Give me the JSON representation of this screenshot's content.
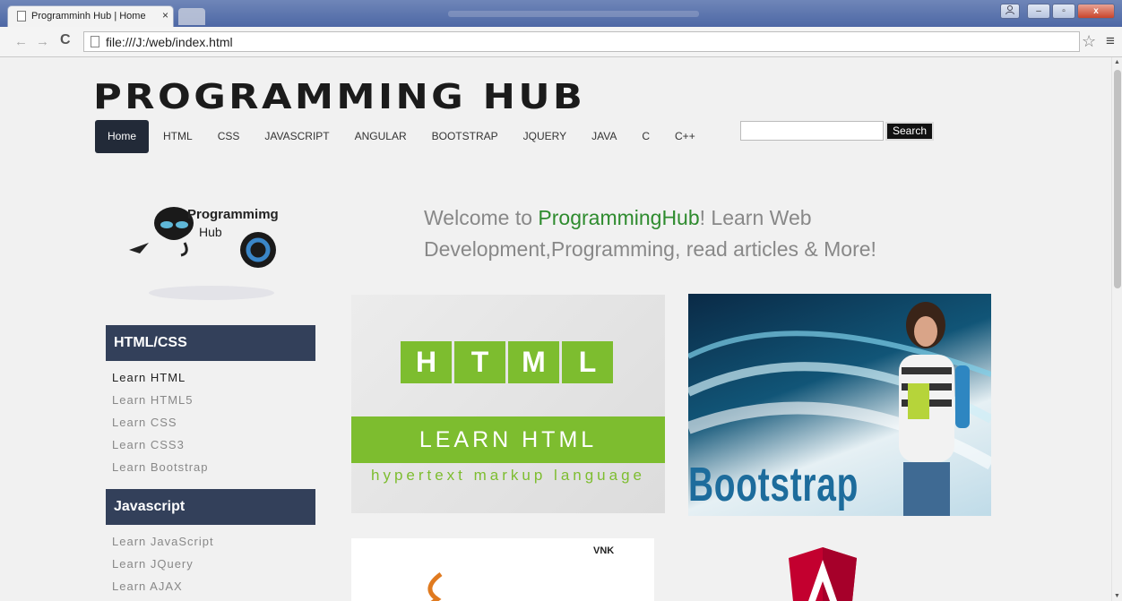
{
  "browser": {
    "tab_title": "Programminh Hub | Home",
    "tab_close": "×",
    "url": "file:///J:/web/index.html",
    "back_glyph": "←",
    "forward_glyph": "→",
    "reload_glyph": "C",
    "star_glyph": "☆",
    "menu_glyph": "≡",
    "window_buttons": {
      "minimize": "–",
      "maximize": "▫",
      "close": "x"
    }
  },
  "site": {
    "logo": "PROGRAMMING HUB",
    "nav": [
      "Home",
      "HTML",
      "CSS",
      "JAVASCRIPT",
      "ANGULAR",
      "BOOTSTRAP",
      "JQUERY",
      "JAVA",
      "C",
      "C++"
    ],
    "search_button": "Search",
    "hero_logo": {
      "line1": "Programmimg",
      "line2": "Hub"
    },
    "welcome": {
      "prefix": "Welcome to ",
      "brand": "ProgrammingHub",
      "suffix": "! Learn Web Development,Programming, read articles & More!"
    },
    "sidebar": [
      {
        "heading": "HTML/CSS",
        "links": [
          "Learn HTML",
          "Learn HTML5",
          "Learn CSS",
          "Learn CSS3",
          "Learn Bootstrap"
        ]
      },
      {
        "heading": "Javascript",
        "links": [
          "Learn JavaScript",
          "Learn JQuery",
          "Learn AJAX"
        ]
      }
    ],
    "cards": {
      "html_letters": [
        "H",
        "T",
        "M",
        "L"
      ],
      "html_band": "LEARN HTML",
      "html_sub": "hypertext markup language",
      "bootstrap": "Bootstrap",
      "java_label": "VNK"
    }
  },
  "colors": {
    "nav_active": "#222a38",
    "sidebar_heading": "#33405a",
    "brand_green": "#2e8b2e",
    "html_green": "#7dbd2f",
    "bootstrap_blue": "#1d6c9c",
    "angular_red": "#c3002f"
  },
  "icons": [
    "page-icon",
    "back-arrow-icon",
    "forward-arrow-icon",
    "reload-icon",
    "file-icon",
    "star-icon",
    "menu-icon",
    "user-icon",
    "alien-icon",
    "java-cup-icon",
    "angular-shield-icon"
  ]
}
